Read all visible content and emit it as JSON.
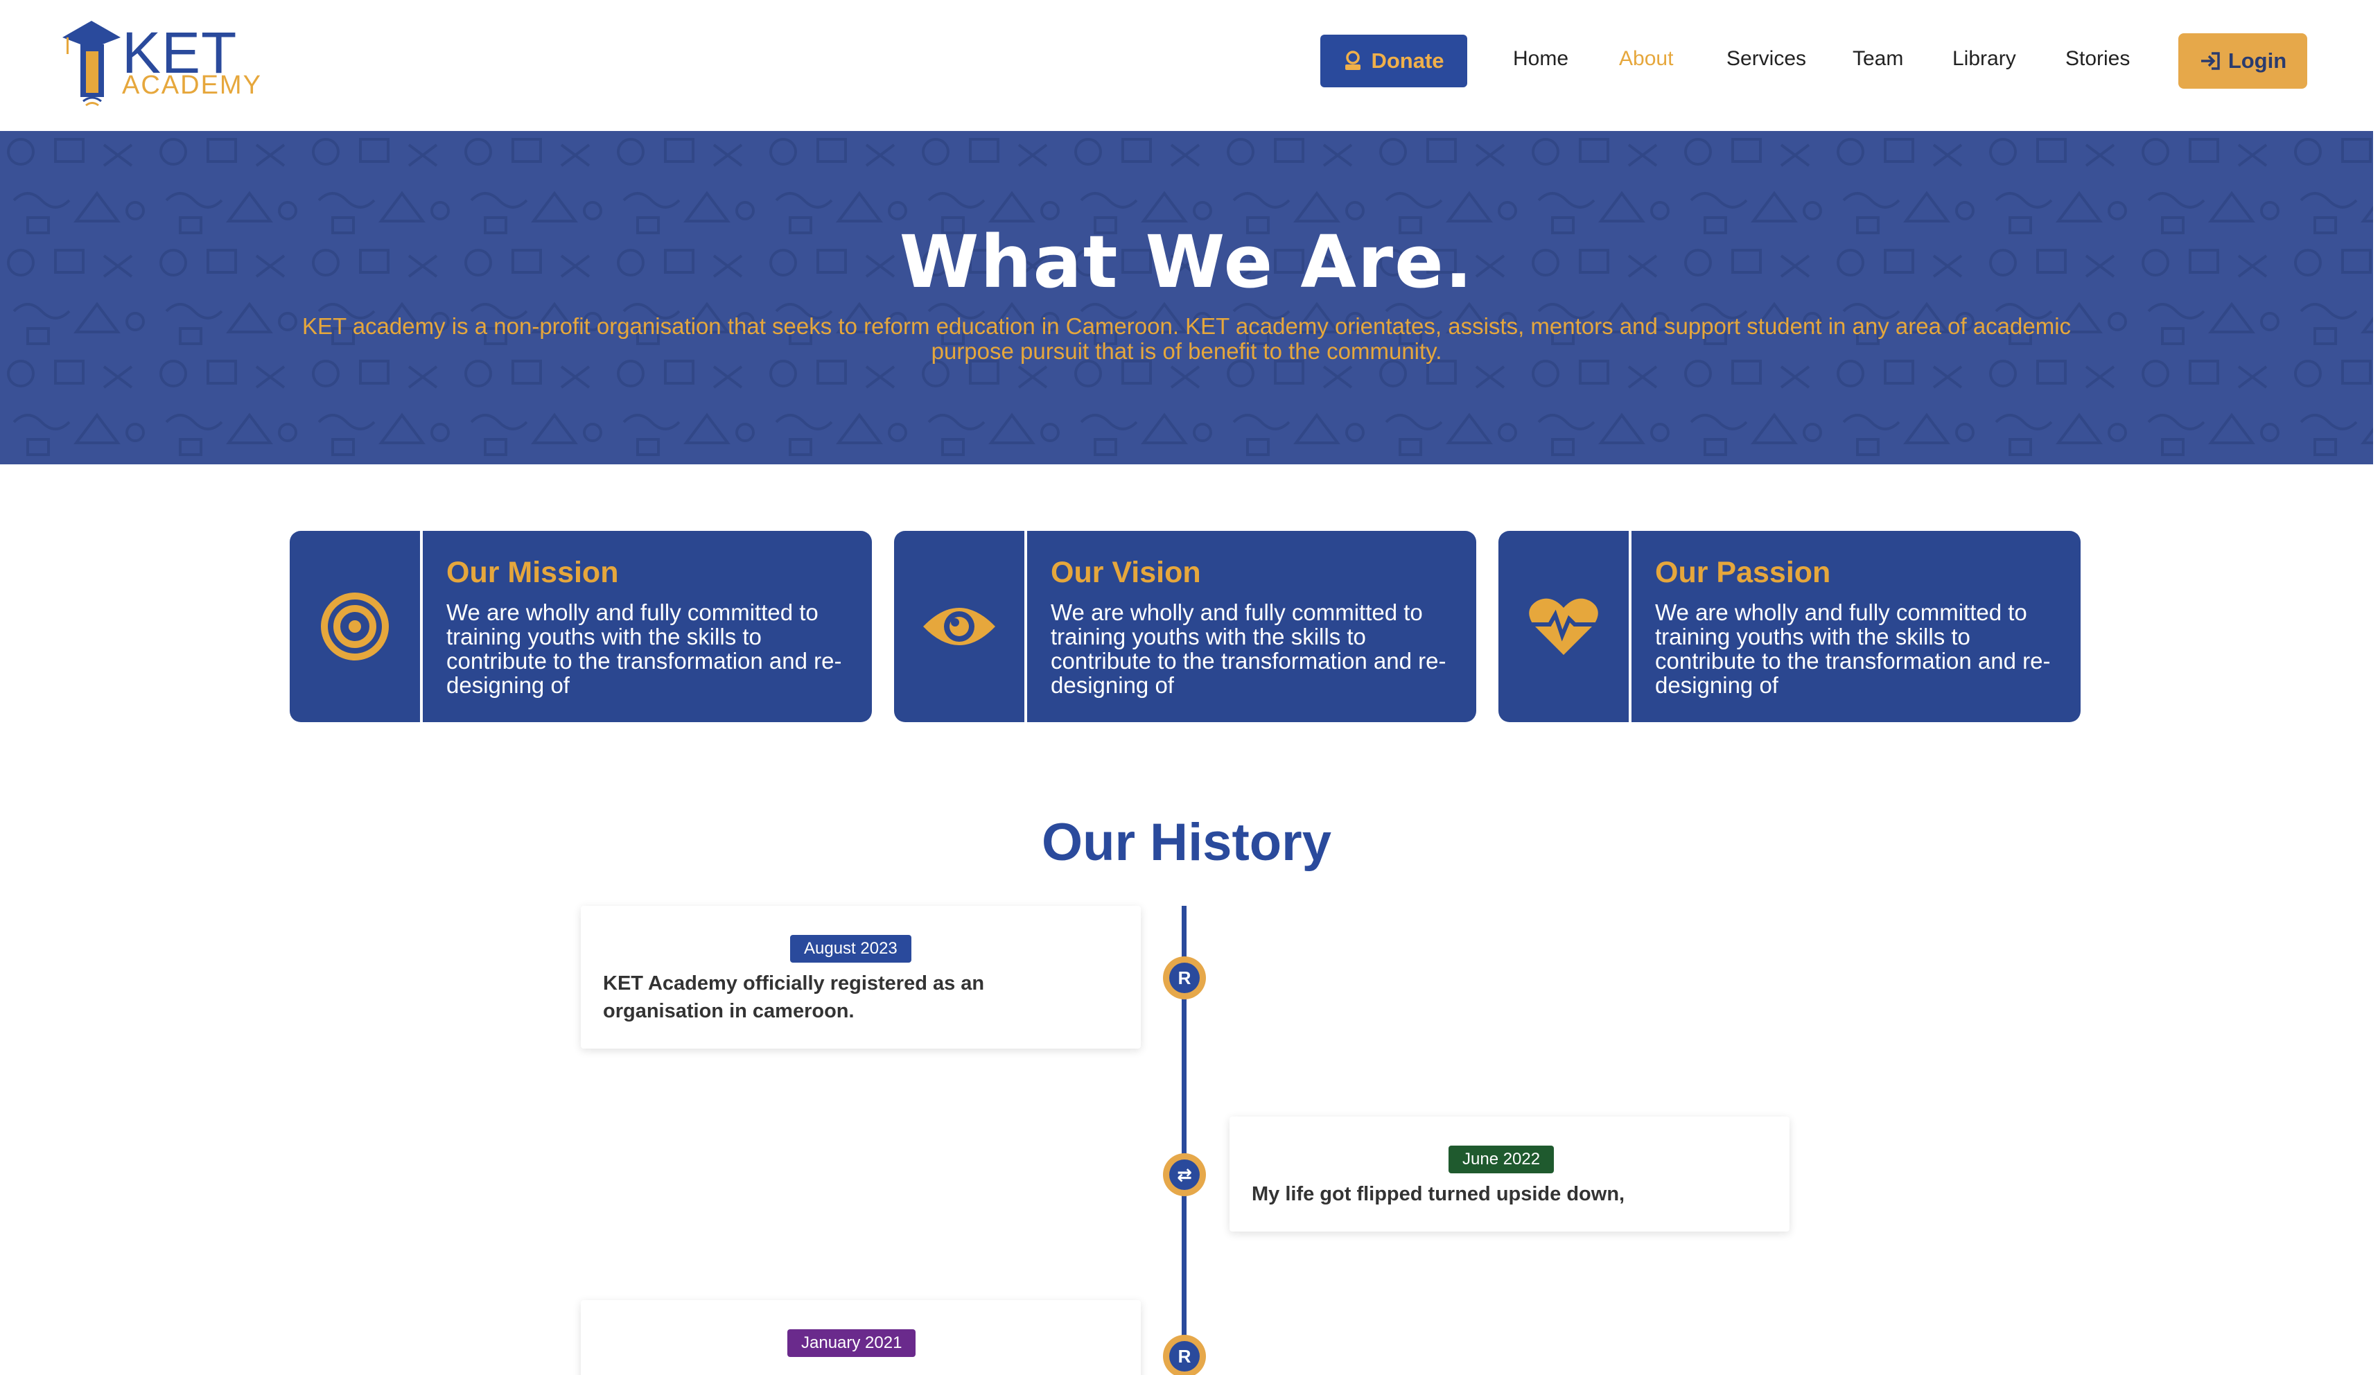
{
  "brand": {
    "name_top": "KET",
    "name_bottom": "ACADEMY",
    "colors": {
      "primary": "#2a4a9c",
      "accent": "#e6a73c",
      "card": "#2b4790"
    }
  },
  "nav": {
    "donate_label": "Donate",
    "donate_icon": "donate-hand-icon",
    "links": [
      "Home",
      "About",
      "Services",
      "Team",
      "Library",
      "Stories"
    ],
    "active": "About",
    "login_label": "Login",
    "login_icon": "login-arrow-icon"
  },
  "hero": {
    "title": "What We Are.",
    "description": "KET academy is a non-profit organisation that seeks to reform education in Cameroon. KET academy orientates, assists, mentors and support student in any area of academic purpose pursuit that is of benefit to the community."
  },
  "cards": [
    {
      "icon": "target-icon",
      "title": "Our Mission",
      "text": "We are wholly and fully committed to training youths with the skills to contribute to the transformation and re-designing of"
    },
    {
      "icon": "eye-icon",
      "title": "Our Vision",
      "text": "We are wholly and fully committed to training youths with the skills to contribute to the transformation and re-designing of"
    },
    {
      "icon": "heartbeat-icon",
      "title": "Our Passion",
      "text": "We are wholly and fully committed to training youths with the skills to contribute to the transformation and re-designing of"
    }
  ],
  "history": {
    "title": "Our History",
    "events": [
      {
        "date": "August 2023",
        "date_color": "#2a4a9c",
        "text": "KET Academy officially registered as an organisation in cameroon.",
        "node_icon": "registered-icon",
        "node_label": "R"
      },
      {
        "date": "June 2022",
        "date_color": "#1f5a2e",
        "text": "My life got flipped turned upside down,",
        "node_icon": "swap-arrows-icon",
        "node_label": "⇄"
      },
      {
        "date": "January 2021",
        "date_color": "#6a2a8c",
        "text": "",
        "node_icon": "registered-icon",
        "node_label": "R"
      }
    ]
  }
}
